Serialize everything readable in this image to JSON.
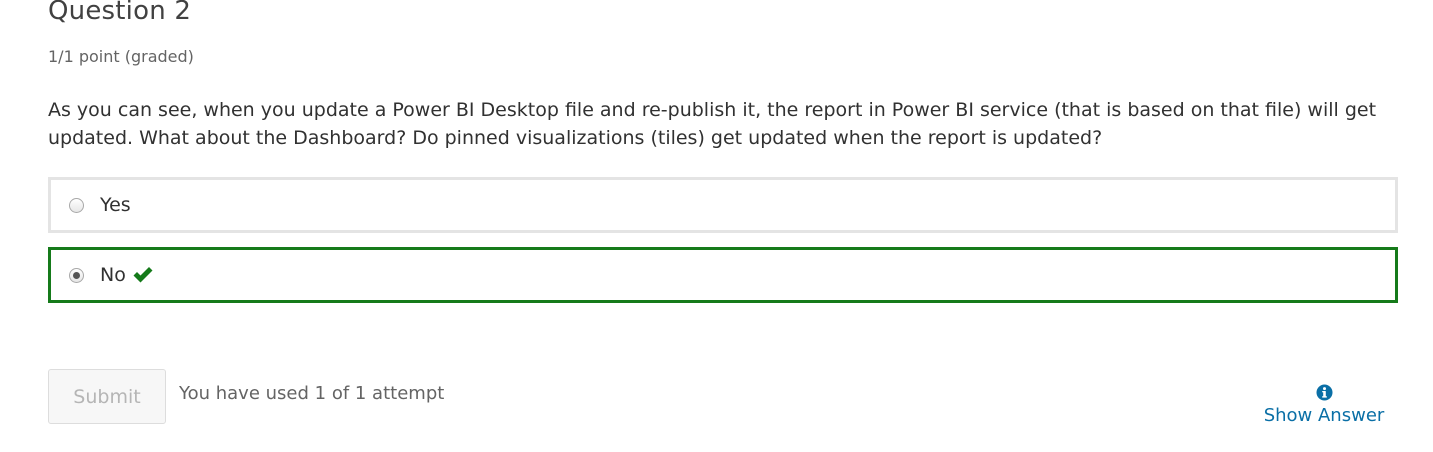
{
  "question": {
    "title": "Question 2",
    "points": "1/1 point (graded)",
    "prompt": "As you can see, when you update a Power BI Desktop file and re-publish it, the report in Power BI service (that is based on that file) will get updated. What about the Dashboard? Do pinned visualizations (tiles) get updated when the report is updated?"
  },
  "choices": [
    {
      "label": "Yes",
      "selected": false
    },
    {
      "label": "No",
      "selected": true,
      "correct": true,
      "icon": "checkmark-icon"
    }
  ],
  "footer": {
    "submit_label": "Submit",
    "attempts_text": "You have used 1 of 1 attempt",
    "show_answer_label": "Show Answer",
    "show_answer_icon": "info-icon"
  },
  "colors": {
    "correct": "#157a1a",
    "link": "#0a6fa6",
    "unselected_border": "#e4e4e4"
  }
}
